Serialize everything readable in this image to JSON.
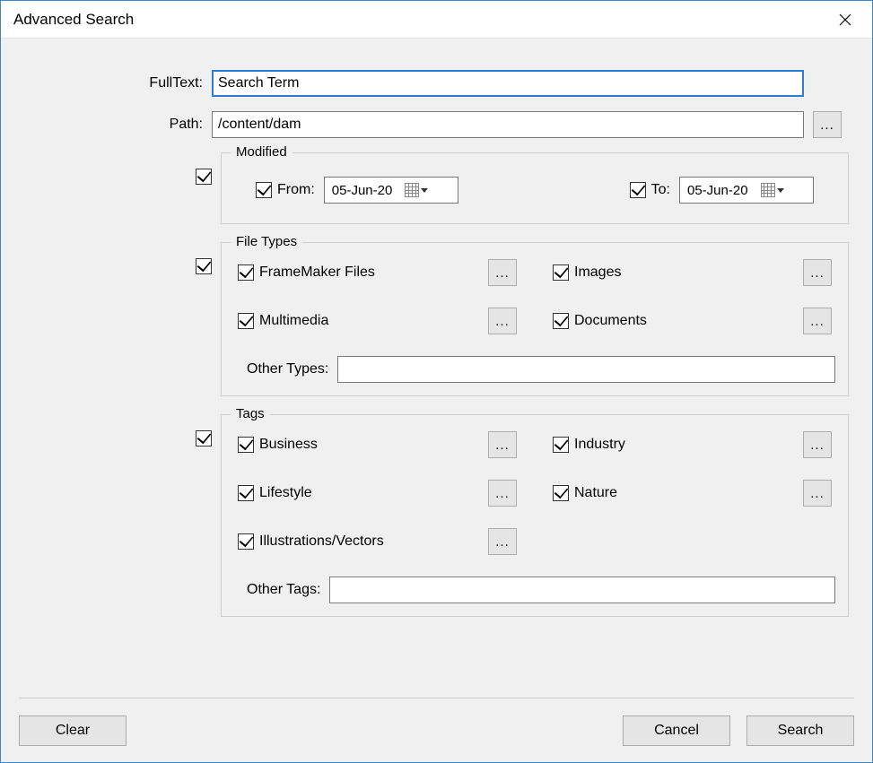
{
  "title": "Advanced Search",
  "labels": {
    "fulltext": "FullText:",
    "path": "Path:"
  },
  "fulltext_value": "Search Term",
  "path_value": "/content/dam",
  "ellipsis": "...",
  "modified": {
    "legend": "Modified",
    "from_label": "From:",
    "to_label": "To:",
    "from_value": "05-Jun-20",
    "to_value": "05-Jun-20"
  },
  "filetypes": {
    "legend": "File Types",
    "items": [
      "FrameMaker Files",
      "Images",
      "Multimedia",
      "Documents"
    ],
    "other_label": "Other Types:",
    "other_value": ""
  },
  "tags": {
    "legend": "Tags",
    "items": [
      "Business",
      "Industry",
      "Lifestyle",
      "Nature",
      "Illustrations/Vectors"
    ],
    "other_label": "Other Tags:",
    "other_value": ""
  },
  "buttons": {
    "clear": "Clear",
    "cancel": "Cancel",
    "search": "Search"
  }
}
